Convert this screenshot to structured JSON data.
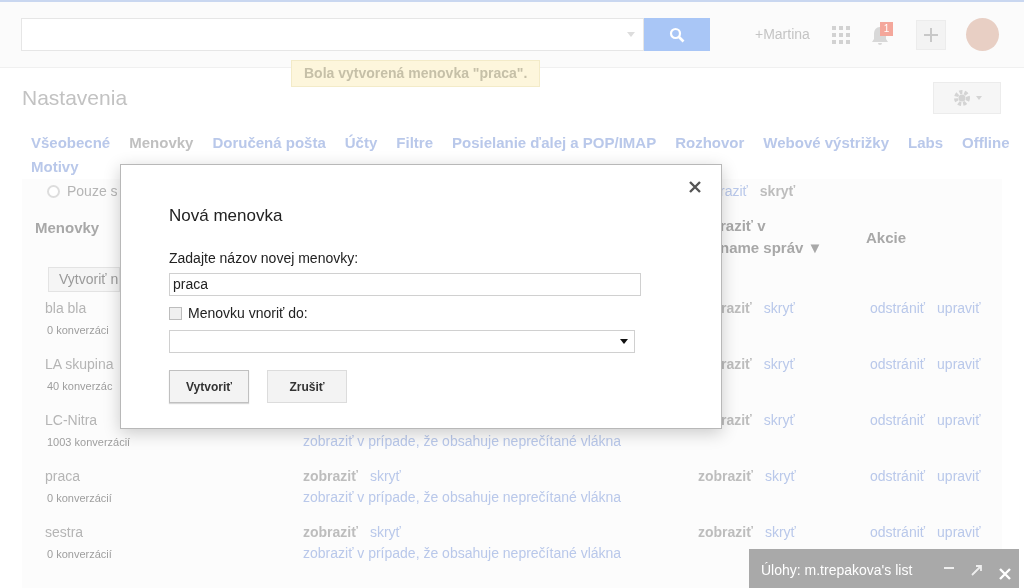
{
  "account": {
    "name": "+Martina"
  },
  "notifications": {
    "count": "1"
  },
  "toast": "Bola vytvorená menovka \"praca\".",
  "page_title": "Nastavenia",
  "tabs": [
    {
      "label": "Všeobecné",
      "selected": false
    },
    {
      "label": "Menovky",
      "selected": true
    },
    {
      "label": "Doručená pošta",
      "selected": false
    },
    {
      "label": "Účty",
      "selected": false
    },
    {
      "label": "Filtre",
      "selected": false
    },
    {
      "label": "Posielanie ďalej a POP/IMAP",
      "selected": false
    },
    {
      "label": "Rozhovor",
      "selected": false
    },
    {
      "label": "Webové výstrižky",
      "selected": false
    },
    {
      "label": "Labs",
      "selected": false
    },
    {
      "label": "Offline",
      "selected": false
    },
    {
      "label": "Motivy",
      "selected": false
    }
  ],
  "filter_row": {
    "radio_label": "Pouze s",
    "selected": false,
    "show_link": "raziť",
    "hide_label": "skryť"
  },
  "table": {
    "columns": [
      {
        "lines": [
          "Menovky"
        ]
      },
      {
        "lines": [
          "raziť v",
          "name správ ▼"
        ]
      },
      {
        "lines": [
          "Akcie"
        ]
      }
    ],
    "create_button": "Vytvoriť n",
    "rows": [
      {
        "kind": "covered",
        "name": "bla bla",
        "count": "0 konverzáci",
        "list_show": "raziť",
        "list_hide": "skryť",
        "actions": [
          "odstrániť",
          "upraviť"
        ]
      },
      {
        "kind": "covered",
        "name": "LA skupina",
        "count": "40 konverzác",
        "list_show": "raziť",
        "list_hide": "skryť",
        "actions": [
          "odstrániť",
          "upraviť"
        ]
      },
      {
        "kind": "covered",
        "name": "LC-Nitra",
        "count": "1003 konverzácií",
        "thread_unread": "zobraziť v prípade, že obsahuje neprečítané vlákna",
        "list_show": "raziť",
        "list_hide": "skryť",
        "actions": [
          "odstrániť",
          "upraviť"
        ]
      },
      {
        "kind": "full",
        "name": "praca",
        "count": "0 konverzácií",
        "thread_show": "zobraziť",
        "thread_hide": "skryť",
        "thread_unread": "zobraziť v prípade, že obsahuje neprečítané vlákna",
        "list_show": "zobraziť",
        "list_hide": "skryť",
        "actions": [
          "odstrániť",
          "upraviť"
        ]
      },
      {
        "kind": "full",
        "name": "sestra",
        "count": "0 konverzácií",
        "thread_show": "zobraziť",
        "thread_hide": "skryť",
        "thread_unread": "zobraziť v prípade, že obsahuje neprečítané vlákna",
        "list_show": "zobraziť",
        "list_hide": "skryť",
        "actions": [
          "odstrániť",
          "upraviť"
        ]
      }
    ]
  },
  "dialog": {
    "title": "Nová menovka",
    "name_label": "Zadajte názov novej menovky:",
    "name_value": "praca",
    "nest_label": "Menovku vnoriť do:",
    "nest_checked": false,
    "buttons": [
      "Vytvoriť",
      "Zrušiť"
    ]
  },
  "tasks_panel": {
    "title": "Úlohy: m.trepakova's list"
  }
}
